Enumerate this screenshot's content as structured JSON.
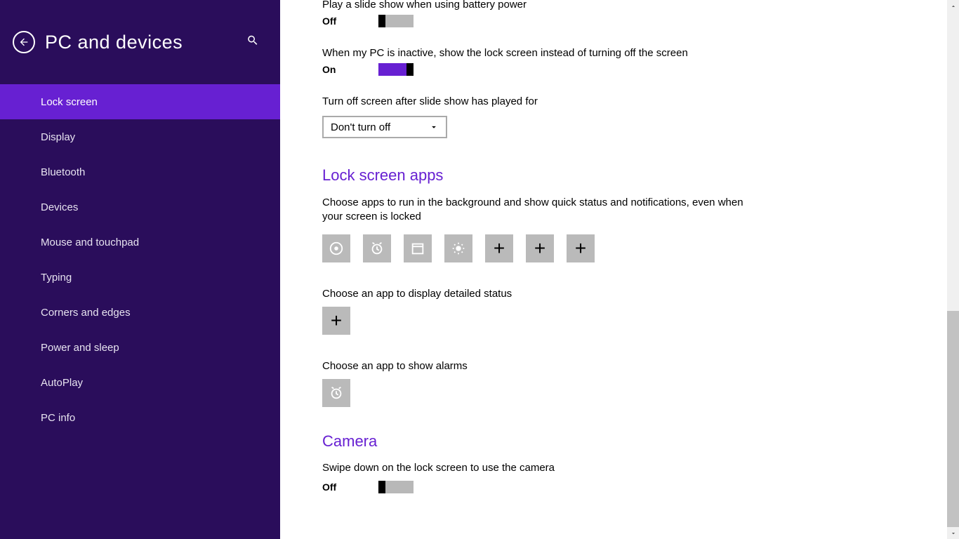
{
  "header": {
    "title": "PC and devices"
  },
  "sidebar": {
    "items": [
      {
        "label": "Lock screen",
        "active": true
      },
      {
        "label": "Display"
      },
      {
        "label": "Bluetooth"
      },
      {
        "label": "Devices"
      },
      {
        "label": "Mouse and touchpad"
      },
      {
        "label": "Typing"
      },
      {
        "label": "Corners and edges"
      },
      {
        "label": "Power and sleep"
      },
      {
        "label": "AutoPlay"
      },
      {
        "label": "PC info"
      }
    ]
  },
  "content": {
    "battery_slideshow": {
      "label": "Play a slide show when using battery power",
      "state": "Off"
    },
    "inactive_lock": {
      "label": "When my PC is inactive, show the lock screen instead of turning off the screen",
      "state": "On"
    },
    "turnoff": {
      "label": "Turn off screen after slide show has played for",
      "value": "Don't turn off"
    },
    "apps_section": {
      "title": "Lock screen apps",
      "desc": "Choose apps to run in the background and show quick status and notifications, even when your screen is locked",
      "detailed_label": "Choose an app to display detailed status",
      "alarms_label": "Choose an app to show alarms"
    },
    "camera_section": {
      "title": "Camera",
      "desc": "Swipe down on the lock screen to use the camera",
      "state": "Off"
    }
  }
}
